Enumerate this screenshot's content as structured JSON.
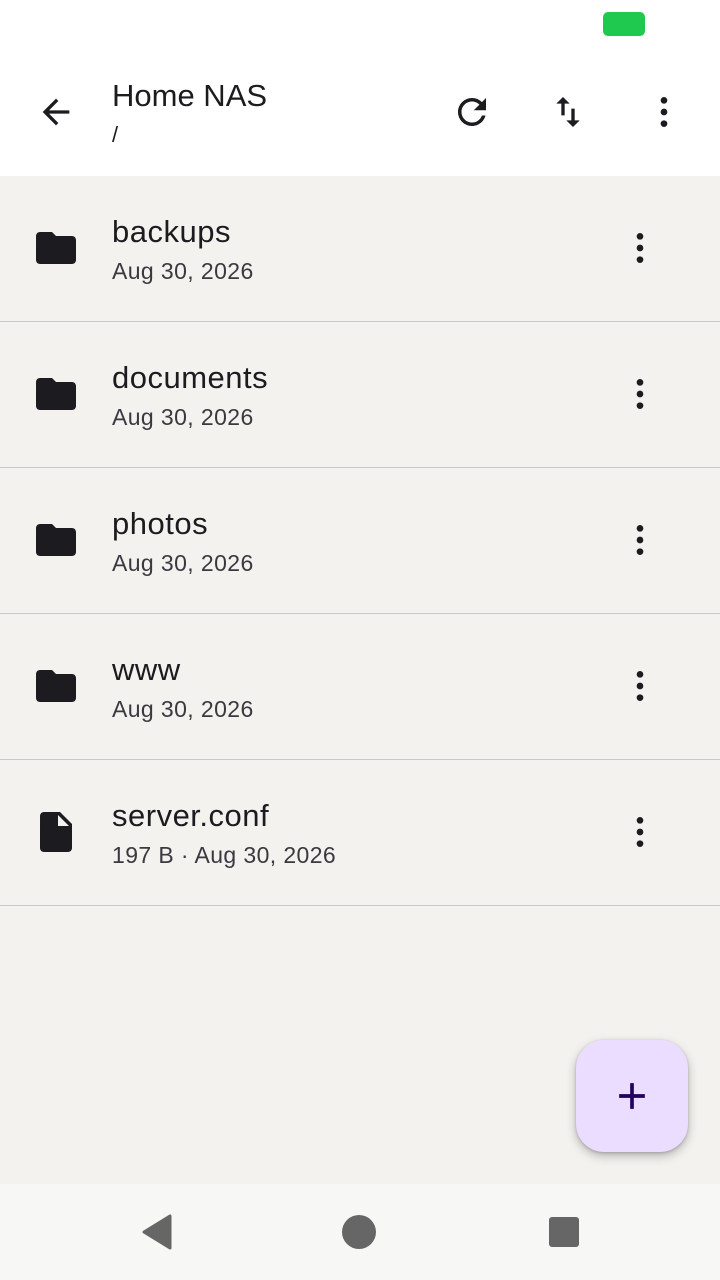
{
  "status_bar": {
    "battery_color": "#1fc84e"
  },
  "app_bar": {
    "title": "Home NAS",
    "path": "/",
    "icons": {
      "back": "arrow-back-icon",
      "refresh": "refresh-icon",
      "sort": "sort-icon",
      "more": "more-vert-icon"
    }
  },
  "files": [
    {
      "name": "backups",
      "meta": "Aug 30, 2026",
      "type": "folder"
    },
    {
      "name": "documents",
      "meta": "Aug 30, 2026",
      "type": "folder"
    },
    {
      "name": "photos",
      "meta": "Aug 30, 2026",
      "type": "folder"
    },
    {
      "name": "www",
      "meta": "Aug 30, 2026",
      "type": "folder"
    },
    {
      "name": "server.conf",
      "meta": "197 B · Aug 30, 2026",
      "type": "file"
    }
  ],
  "fab": {
    "icon": "add-icon",
    "color": "#eaddff",
    "icon_color": "#21005d"
  },
  "nav_bar": {
    "icons": [
      "nav-back-icon",
      "nav-home-icon",
      "nav-recents-icon"
    ]
  },
  "colors": {
    "background": "#f3f2ef",
    "app_bar": "#ffffff",
    "text": "#1c1b1f",
    "divider": "#c9c7cc"
  }
}
